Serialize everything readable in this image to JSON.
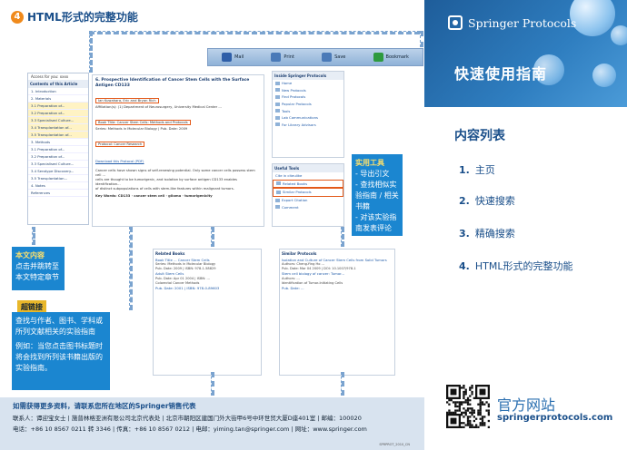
{
  "heading": {
    "num": "4",
    "text": "HTML形式的完整功能"
  },
  "toolbar": {
    "items": [
      {
        "label": "Mail",
        "icon": "mail-icon",
        "color": "#2e5ea8"
      },
      {
        "label": "Print",
        "icon": "print-icon",
        "color": "#4a7ab8"
      },
      {
        "label": "Save",
        "icon": "save-icon",
        "color": "#4a7ab8"
      },
      {
        "label": "Bookmark",
        "icon": "bookmark-icon",
        "color": "#2e9a3e"
      }
    ]
  },
  "left_panel": {
    "head": "Access for you: xxxx",
    "title": "Contents of this Article",
    "items": [
      "1. Introduction",
      "2. Materials",
      "3.1 Preparation of...",
      "3.2 Preparation of...",
      "3.3 Specialised Culture...",
      "3.4 Transplantation of...",
      "3.5 Transplantation of...",
      "3. Methods",
      "3.1 Preparation of...",
      "3.2 Preparation of...",
      "3.3 Specialised Culture...",
      "3.4 Serotype Discovery...",
      "3.5 Transplantation...",
      "4. Notes",
      "References"
    ]
  },
  "article": {
    "title": "6. Prospective Identification of Cancer Stem Cells with the Surface Antigen CD133",
    "authors": "Ian Kuwahara, Eric and Bryan Rich",
    "affil": "Affiliation(s): (1) Department of Neurosurgery, University Medical Center ...",
    "book_title": "Book Title: Cancer Stem Cells: Methods and Protocols",
    "series": "Series: Methods in Molecular Biology  |  Pub. Date: 2009",
    "protocol": "Protocol: Cancer Research",
    "download": "Download this Protocol (PDF)",
    "abstract_1": "Cancer cells have shown signs of self-renewing potential. Only some cancer cells possess stem cell ...",
    "abstract_2": "cells are thought to be tumorigenic, and isolation by surface antigen CD133 enables identification...",
    "abstract_3": "of distinct subpopulations of cells with stem-like features within malignant tumors.",
    "keywords": "Key Words: CD133 · cancer stem cell · glioma · tumorigenicity"
  },
  "rpanel": {
    "title": "Inside Springer Protocols",
    "items": [
      "Home",
      "New Protocols",
      "Find Protocols",
      "Popular Protocols",
      "Tools",
      "Lab Communications",
      "For Library Advisors"
    ]
  },
  "rpanel2": {
    "title": "Useful Tools",
    "cite_label": "Cite in citeulike",
    "tools": [
      "Related Books",
      "Similar Protocols",
      "Export Citation",
      "Comment"
    ]
  },
  "callouts": {
    "tools_title": "实用工具",
    "tools_lines": [
      "- 导出引文",
      "- 查找相似实验指南 / 相关书籍",
      "- 对该实验指南发表评论"
    ],
    "content_title": "本文内容",
    "content_text": "点击并跳转至本文特定章节",
    "hyperlink": "超链接",
    "hyperlink_lines": [
      "查找与作者、图书、学科或所列文献相关的实验指南",
      "例如：当您点击图书标题时将会找到所列该书籍出版的实验指南。"
    ]
  },
  "related_books": {
    "head": "Related Books",
    "lines": [
      "Book Title ... Cancer Stem Cells",
      "Series: Methods in Molecular Biology",
      "Pub. Date: 2009 | ISBN: 978-1-58829",
      "Adult Stem Cells",
      "Pub. Date: Apr 01 2004 | ISBN: ...",
      "Colorectal Cancer Methods",
      "Pub. Date: 2001 | ISBN: 978-0-89603"
    ]
  },
  "similar_protocols": {
    "head": "Similar Protocols",
    "lines": [
      "Isolation and Culture of Cancer Stem Cells from Solid Tumors",
      "Authors: Cheng-Ying Ho ...",
      "Pub. Date: Mar 04 2009 | DOI: 10.1007/978-1",
      "Stem cell biology of cancer: Tumor...",
      "Authors: ...",
      "Identification of Tumor-Initiating Cells",
      "Pub. Date: ..."
    ]
  },
  "footer": {
    "line1": "如需获得更多资料，请联系您所在地区的Springer销售代表",
    "line2": "联系人：谭迎宝女士 | 施普林格亚洲有限公司北京代表处 | 北京市朝阳区建国门外大街甲6号中环世贸大厦D座401室 | 邮编：100020",
    "line3": "电话：+86 10 8567 0211 转 3346 | 传真：+86 10 8567 0212 | 电邮：yiming.tan@springer.com | 网址：www.springer.com",
    "code": "SPRPROT_2010_CN"
  },
  "brand": {
    "name": "Springer Protocols",
    "quick_guide": "快速使用指南",
    "bg": "#1e5d9a"
  },
  "toc": {
    "title": "内容列表",
    "items": [
      {
        "num": "1.",
        "text": "主页"
      },
      {
        "num": "2.",
        "text": "快速搜索"
      },
      {
        "num": "3.",
        "text": "精确搜索"
      },
      {
        "num": "4.",
        "text": "HTML形式的完整功能"
      }
    ]
  },
  "site": {
    "cn": "官方网站",
    "url": "springerprotocols.com"
  }
}
